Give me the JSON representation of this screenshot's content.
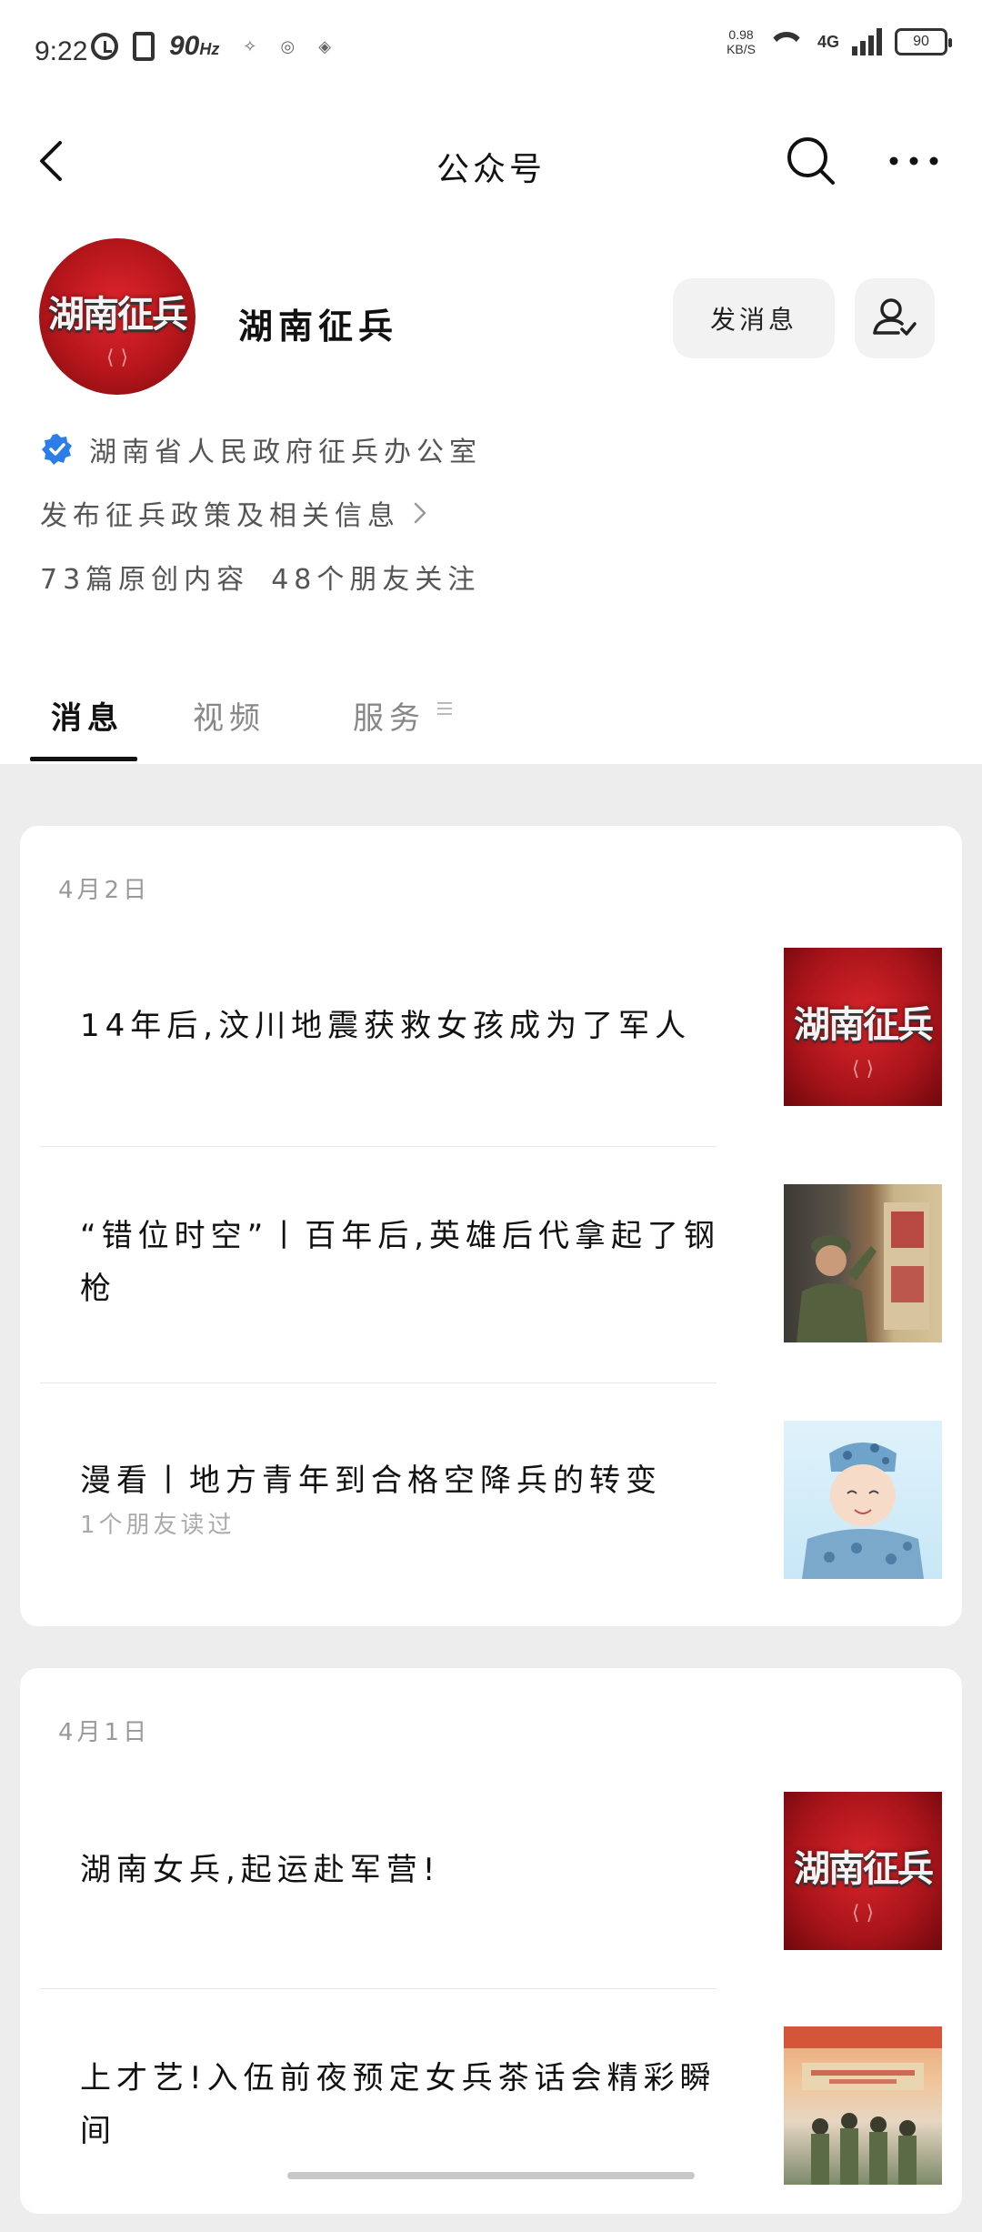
{
  "status_bar": {
    "time": "9:22",
    "refresh_rate": "90",
    "refresh_unit": "Hz",
    "net_speed_value": "0.98",
    "net_speed_unit": "KB/S",
    "network": "4G",
    "battery": "90"
  },
  "nav": {
    "title": "公众号"
  },
  "profile": {
    "avatar_logo": "湖南征兵",
    "name": "湖南征兵",
    "send_message_label": "发消息",
    "verified_org": "湖南省人民政府征兵办公室",
    "description": "发布征兵政策及相关信息",
    "stats": {
      "original": "73篇原创内容",
      "friends": "48个朋友关注"
    }
  },
  "tabs": [
    {
      "label": "消息"
    },
    {
      "label": "视频"
    },
    {
      "label": "服务"
    }
  ],
  "groups": [
    {
      "date": "4月2日",
      "articles": [
        {
          "title": "14年后,汶川地震获救女孩成为了军人",
          "meta": "",
          "thumb_text": "湖南征兵"
        },
        {
          "title": "“错位时空”丨百年后,英雄后代拿起了钢枪",
          "meta": ""
        },
        {
          "title": "漫看丨地方青年到合格空降兵的转变",
          "meta": "1个朋友读过"
        }
      ]
    },
    {
      "date": "4月1日",
      "articles": [
        {
          "title": "湖南女兵,起运赴军营!",
          "meta": "",
          "thumb_text": "湖南征兵"
        },
        {
          "title": "上才艺!入伍前夜预定女兵茶话会精彩瞬间",
          "meta": ""
        }
      ]
    }
  ],
  "colors": {
    "brand_red": "#c81c22",
    "verified_blue": "#2b7de9",
    "page_bg": "#ededed"
  },
  "icons": {
    "back": "chevron-left-icon",
    "search": "search-icon",
    "more": "more-dots-icon",
    "follow": "user-check-icon",
    "verified": "verified-badge-icon",
    "chevron": "chevron-right-icon",
    "tab_menu": "menu-lines-icon"
  }
}
